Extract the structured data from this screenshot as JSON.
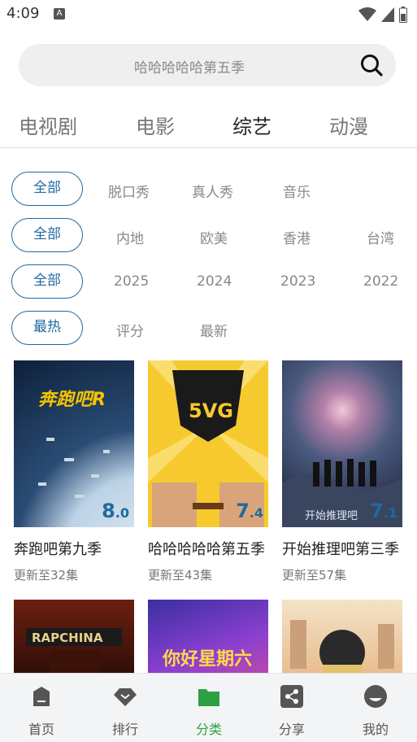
{
  "status_bar": {
    "time": "4:09",
    "notif_letter": "A"
  },
  "search": {
    "placeholder": "哈哈哈哈哈第五季"
  },
  "top_tabs": [
    {
      "label": "电视剧"
    },
    {
      "label": "电影"
    },
    {
      "label": "综艺",
      "active": true
    },
    {
      "label": "动漫"
    }
  ],
  "filters": {
    "genre": {
      "selected": "全部",
      "options": [
        "脱口秀",
        "真人秀",
        "音乐"
      ]
    },
    "region": {
      "selected": "全部",
      "options": [
        "内地",
        "欧美",
        "香港",
        "台湾"
      ]
    },
    "year": {
      "selected": "全部",
      "options": [
        "2025",
        "2024",
        "2023",
        "2022"
      ]
    },
    "sort": {
      "selected": "最热",
      "options": [
        "评分",
        "最新"
      ]
    }
  },
  "shows": [
    {
      "title": "奔跑吧第九季",
      "update": "更新至32集",
      "score_int": "8",
      "score_dec": ".0"
    },
    {
      "title": "哈哈哈哈哈第五季",
      "update": "更新至43集",
      "score_int": "7",
      "score_dec": ".4"
    },
    {
      "title": "开始推理吧第三季",
      "update": "更新至57集",
      "score_int": "7",
      "score_dec": ".1"
    }
  ],
  "bottom_nav": [
    {
      "label": "首页",
      "icon": "home-icon"
    },
    {
      "label": "排行",
      "icon": "ranking-icon"
    },
    {
      "label": "分类",
      "icon": "folder-icon",
      "active": true
    },
    {
      "label": "分享",
      "icon": "share-icon"
    },
    {
      "label": "我的",
      "icon": "profile-icon"
    }
  ],
  "colors": {
    "accent": "#1e6aa0",
    "nav_active": "#2ea043"
  }
}
